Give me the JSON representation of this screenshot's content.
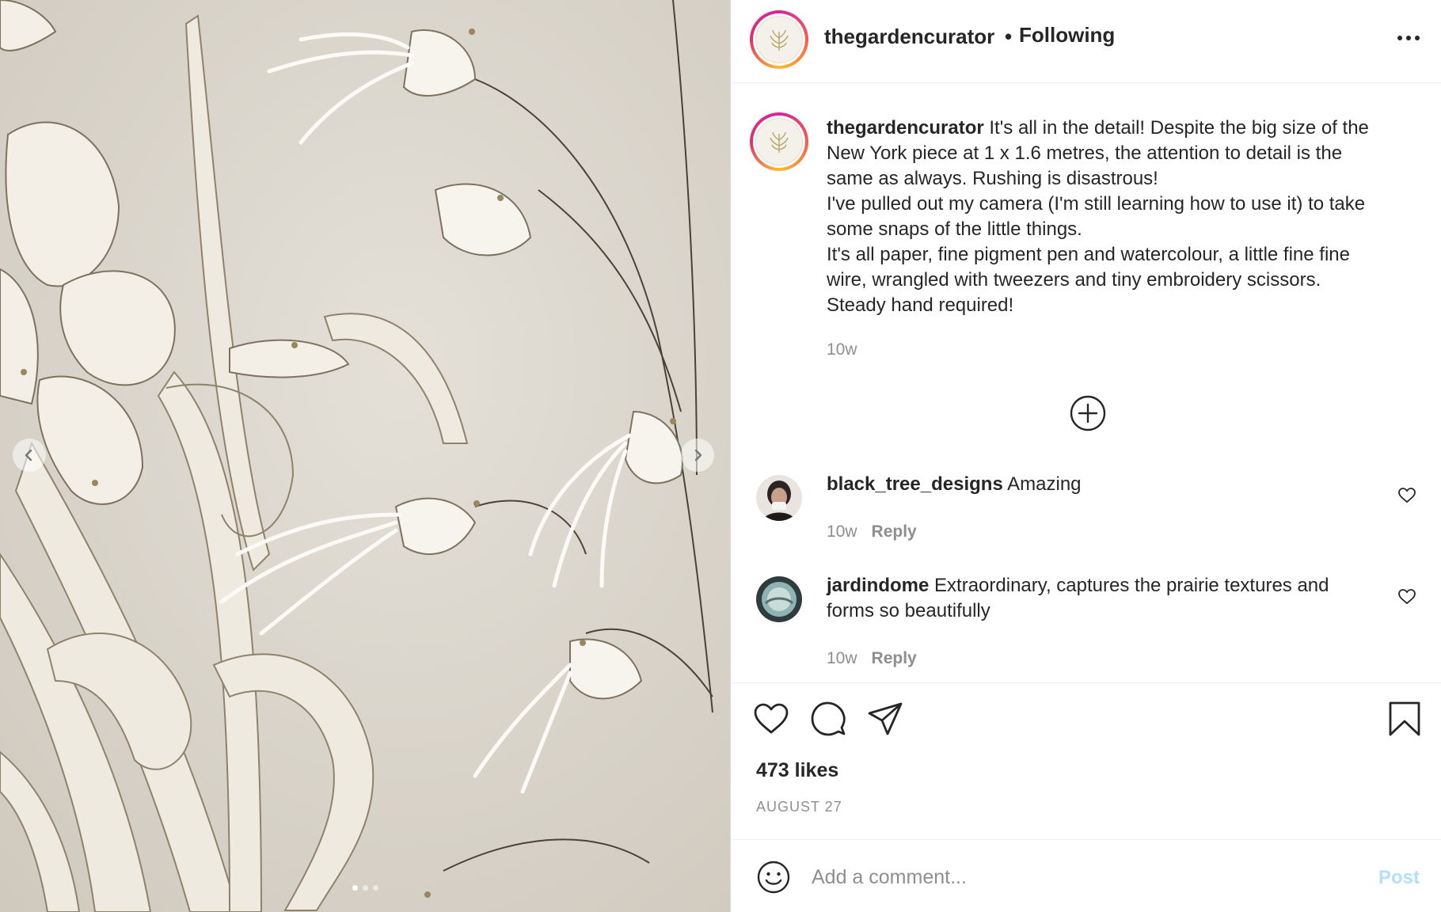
{
  "post": {
    "username": "thegardencurator",
    "separator": "•",
    "follow_status": "Following",
    "more_icon": "more-horizontal-icon"
  },
  "caption": {
    "username": "thegardencurator",
    "lines": [
      "It's all in the detail! Despite the big size of the",
      "New York piece at 1 x 1.6 metres, the attention to detail is the",
      "same as always. Rushing is disastrous!",
      "I've pulled out my camera (I'm still learning how to use it) to take",
      "some snaps of the little things.",
      "It's all paper, fine pigment pen and watercolour, a little fine fine",
      "wire, wrangled with tweezers and tiny embroidery scissors.",
      "Steady hand required!"
    ],
    "time": "10w"
  },
  "load_more_icon": "plus-circle-icon",
  "comments": [
    {
      "username": "black_tree_designs",
      "text": "Amazing",
      "time": "10w",
      "reply_label": "Reply"
    },
    {
      "username": "jardindome",
      "text_line1": "Extraordinary, captures the prairie textures and",
      "text_line2": "forms so beautifully",
      "time": "10w",
      "reply_label": "Reply"
    }
  ],
  "actions": {
    "like_icon": "heart-icon",
    "comment_icon": "comment-icon",
    "share_icon": "paper-plane-icon",
    "save_icon": "bookmark-icon"
  },
  "likes_text": "473 likes",
  "date_text": "AUGUST 27",
  "comment_box": {
    "placeholder": "Add a comment...",
    "post_label": "Post",
    "emoji_icon": "smiley-icon"
  },
  "carousel": {
    "prev_icon": "chevron-left-icon",
    "next_icon": "chevron-right-icon",
    "slide_count": 3,
    "active_slide": 1
  },
  "colors": {
    "primary_text": "#262626",
    "secondary_text": "#8e8e8e",
    "post_button_disabled": "#b2dffc",
    "border": "#dbdbdb"
  }
}
